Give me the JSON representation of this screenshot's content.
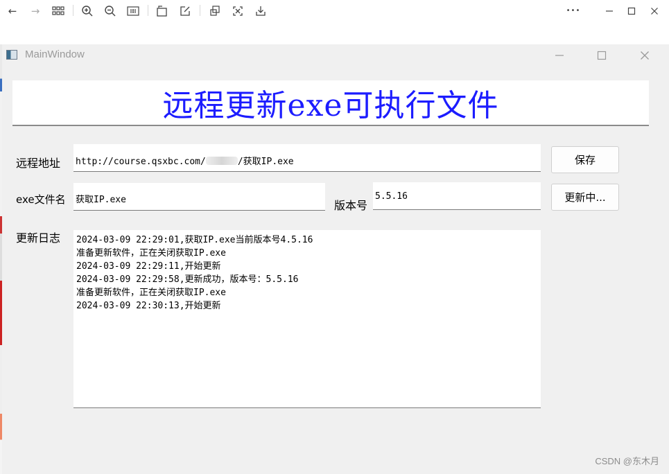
{
  "viewer_toolbar": {
    "icons": [
      "back-icon",
      "forward-icon",
      "grid-icon",
      "zoom-in-icon",
      "zoom-out-icon",
      "actual-size-icon",
      "rotate-icon",
      "edit-icon",
      "crop-icon",
      "fullscreen-icon",
      "download-icon"
    ],
    "more_glyph": "•••"
  },
  "window": {
    "title": "MainWindow",
    "header_title": "远程更新exe可执行文件"
  },
  "form": {
    "remote_url_label": "远程地址",
    "remote_url_prefix": "http://course.qsxbc.com/",
    "remote_url_suffix": "/获取IP.exe",
    "save_button": "保存",
    "exe_name_label": "exe文件名",
    "exe_name_value": "获取IP.exe",
    "version_label": "版本号",
    "version_value": "5.5.16",
    "update_button": "更新中..."
  },
  "log": {
    "label": "更新日志",
    "lines": [
      "2024-03-09 22:29:01,获取IP.exe当前版本号4.5.16",
      "准备更新软件，正在关闭获取IP.exe",
      "2024-03-09 22:29:11,开始更新",
      "2024-03-09 22:29:58,更新成功，版本号：5.5.16",
      "准备更新软件，正在关闭获取IP.exe",
      "2024-03-09 22:30:13,开始更新"
    ]
  },
  "watermark": "CSDN @东木月",
  "colors": {
    "header_text": "#1c1cff",
    "window_bg": "#f0f0f0"
  }
}
